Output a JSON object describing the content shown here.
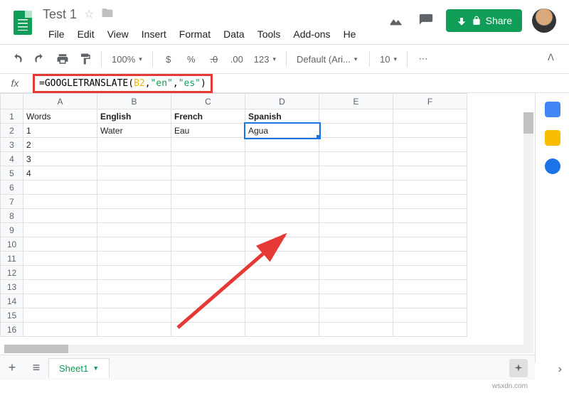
{
  "doc": {
    "title": "Test 1"
  },
  "menu": {
    "file": "File",
    "edit": "Edit",
    "view": "View",
    "insert": "Insert",
    "format": "Format",
    "data": "Data",
    "tools": "Tools",
    "addons": "Add-ons",
    "help": "He"
  },
  "actions": {
    "share": "Share"
  },
  "toolbar": {
    "zoom": "100%",
    "currency": "$",
    "percent": "%",
    "dec_dec": ".0",
    "dec_inc": ".00",
    "numfmt": "123",
    "font": "Default (Ari...",
    "fontsize": "10"
  },
  "formula": {
    "fx": "fx",
    "eq": "=",
    "fn": "GOOGLETRANSLATE",
    "open": "(",
    "ref": "B2",
    "c1": ", ",
    "s1": "\"en\"",
    "c2": ", ",
    "s2": "\"es\"",
    "close": ")"
  },
  "cols": [
    "A",
    "B",
    "C",
    "D",
    "E",
    "F"
  ],
  "rows": [
    1,
    2,
    3,
    4,
    5,
    6,
    7,
    8,
    9,
    10,
    11,
    12,
    13,
    14,
    15,
    16
  ],
  "cells": {
    "A1": "Words",
    "B1": "English",
    "C1": "French",
    "D1": "Spanish",
    "A2": "1",
    "B2": "Water",
    "C2": "Eau",
    "D2": "Agua",
    "A3": "2",
    "A4": "3",
    "A5": "4"
  },
  "tabs": {
    "sheet1": "Sheet1"
  },
  "watermark": "wsxdn.com"
}
